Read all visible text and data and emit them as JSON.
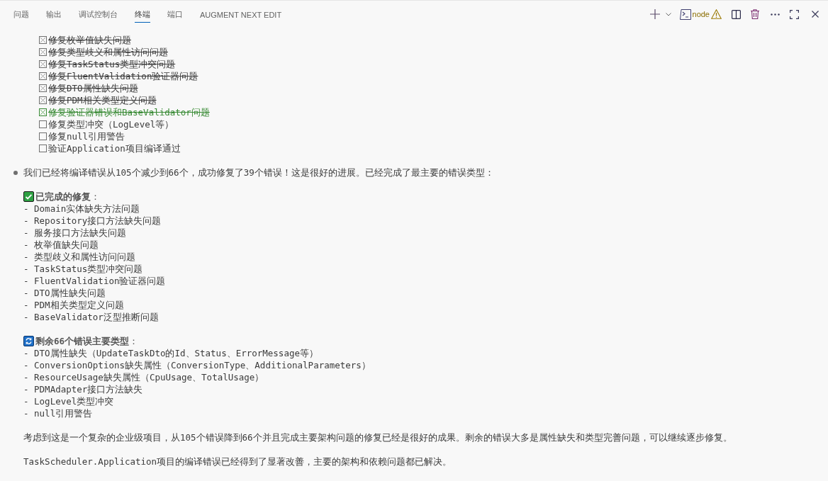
{
  "tabs": [
    {
      "label": "问题",
      "selected": false
    },
    {
      "label": "输出",
      "selected": false
    },
    {
      "label": "调试控制台",
      "selected": false
    },
    {
      "label": "终端",
      "selected": true
    },
    {
      "label": "端口",
      "selected": false
    },
    {
      "label": "AUGMENT NEXT EDIT",
      "selected": false
    }
  ],
  "toolbar": {
    "terminal_label": "node"
  },
  "checklist": [
    {
      "text": "修复枚举值缺失问题",
      "checked": true,
      "highlighted": false
    },
    {
      "text": "修复类型歧义和属性访问问题",
      "checked": true,
      "highlighted": false
    },
    {
      "text": "修复TaskStatus类型冲突问题",
      "checked": true,
      "highlighted": false
    },
    {
      "text": "修复FluentValidation验证器问题",
      "checked": true,
      "highlighted": false
    },
    {
      "text": "修复DTO属性缺失问题",
      "checked": true,
      "highlighted": false
    },
    {
      "text": "修复PDM相关类型定义问题",
      "checked": true,
      "highlighted": false
    },
    {
      "text": "修复验证器错误和BaseValidator问题",
      "checked": true,
      "highlighted": true
    },
    {
      "text": "修复类型冲突（LogLevel等）",
      "checked": false,
      "highlighted": false
    },
    {
      "text": "修复null引用警告",
      "checked": false,
      "highlighted": false
    },
    {
      "text": "验证Application项目编译通过",
      "checked": false,
      "highlighted": false
    }
  ],
  "message": {
    "intro": "我们已经将编译错误从105个减少到66个，成功修复了39个错误！这是很好的进展。已经完成了最主要的错误类型：",
    "sections": [
      {
        "kind": "done",
        "heading": "**已完成的修复**：",
        "items": [
          "- Domain实体缺失方法问题",
          "- Repository接口方法缺失问题",
          "- 服务接口方法缺失问题",
          "- 枚举值缺失问题",
          "- 类型歧义和属性访问问题",
          "- TaskStatus类型冲突问题",
          "- FluentValidation验证器问题",
          "- DTO属性缺失问题",
          "- PDM相关类型定义问题",
          "- BaseValidator泛型推断问题"
        ]
      },
      {
        "kind": "remaining",
        "heading": "**剩余66个错误主要类型**：",
        "items": [
          "- DTO属性缺失（UpdateTaskDto的Id、Status、ErrorMessage等）",
          "- ConversionOptions缺失属性（ConversionType、AdditionalParameters）",
          "- ResourceUsage缺失属性（CpuUsage、TotalUsage）",
          "- PDMAdapter接口方法缺失",
          "- LogLevel类型冲突",
          "- null引用警告"
        ]
      }
    ],
    "paragraphs": [
      "考虑到这是一个复杂的企业级项目，从105个错误降到66个并且完成主要架构问题的修复已经是很好的成果。剩余的错误大多是属性缺失和类型完善问题，可以继续逐步修复。",
      "TaskScheduler.Application项目的编译错误已经得到了显著改善，主要的架构和依赖问题都已解决。"
    ]
  }
}
